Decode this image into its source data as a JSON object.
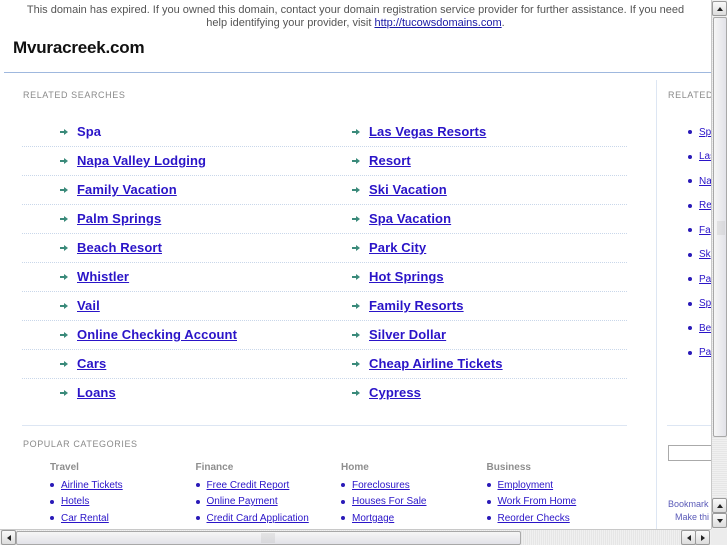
{
  "notice": {
    "line1": "This domain has expired. If you owned this domain, contact your domain registration service provider for further assistance. If you need",
    "line2_prefix": "help identifying your provider, visit ",
    "link": "http://tucowsdomains.com",
    "line2_suffix": "."
  },
  "site_title": "Mvuracreek.com",
  "related_searches": {
    "label": "RELATED SEARCHES",
    "rows": [
      [
        "Spa",
        "Las Vegas Resorts"
      ],
      [
        "Napa Valley Lodging",
        "Resort"
      ],
      [
        "Family Vacation",
        "Ski Vacation"
      ],
      [
        "Palm Springs",
        "Spa Vacation"
      ],
      [
        "Beach Resort",
        "Park City"
      ],
      [
        "Whistler",
        "Hot Springs"
      ],
      [
        "Vail",
        "Family Resorts"
      ],
      [
        "Online Checking Account",
        "Silver Dollar"
      ],
      [
        "Cars",
        "Cheap Airline Tickets"
      ],
      [
        "Loans",
        "Cypress"
      ]
    ]
  },
  "popular_categories": {
    "label": "POPULAR CATEGORIES",
    "columns": [
      {
        "heading": "Travel",
        "items": [
          "Airline Tickets",
          "Hotels",
          "Car Rental"
        ]
      },
      {
        "heading": "Finance",
        "items": [
          "Free Credit Report",
          "Online Payment",
          "Credit Card Application"
        ]
      },
      {
        "heading": "Home",
        "items": [
          "Foreclosures",
          "Houses For Sale",
          "Mortgage"
        ]
      },
      {
        "heading": "Business",
        "items": [
          "Employment",
          "Work From Home",
          "Reorder Checks"
        ]
      }
    ]
  },
  "sidebar": {
    "label": "RELATED",
    "items": [
      "Sp",
      "Las",
      "Na",
      "Re",
      "Fa",
      "Sk",
      "Pa",
      "Sp",
      "Be",
      "Pa"
    ],
    "search_value": "",
    "bookmark": "Bookmark",
    "make": "Make thi"
  },
  "colors": {
    "link": "#2a14c8",
    "arrow": "#3a8a7a",
    "rule": "#9fb8de"
  }
}
